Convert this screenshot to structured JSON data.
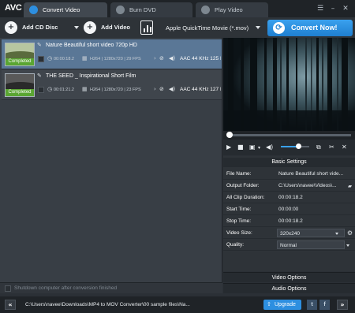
{
  "app": {
    "logo": "AVC"
  },
  "tabs": [
    {
      "label": "Convert Video",
      "icon": "refresh-icon",
      "active": true
    },
    {
      "label": "Burn DVD",
      "icon": "disc-icon",
      "active": false
    },
    {
      "label": "Play Video",
      "icon": "play-icon",
      "active": false
    }
  ],
  "window_controls": {
    "menu": "☰",
    "minimize": "–",
    "close": "✕"
  },
  "toolbar": {
    "add_cd_label": "Add CD Disc",
    "add_video_label": "Add Video",
    "format_value": "Apple QuickTime Movie (*.mov)",
    "convert_label": "Convert Now!"
  },
  "files": [
    {
      "title": "Nature Beautiful short video 720p HD",
      "status": "Completed",
      "duration": "00:00:18.2",
      "video_info": "H264 | 1280x720 | 29 FPS",
      "audio_info": "AAC 44 KHz 125 K",
      "selected": true
    },
    {
      "title": "THE SEED _ Inspirational Short Film",
      "status": "Completed",
      "duration": "00:01:21.2",
      "video_info": "H264 | 1280x720 | 23 FPS",
      "audio_info": "AAC 44 KHz 127 K",
      "selected": false
    }
  ],
  "shutdown_label": "Shutdown computer after conversion finished",
  "player": {
    "seek_fraction": 0.02,
    "volume_fraction": 0.62
  },
  "settings": {
    "header": "Basic Settings",
    "rows": [
      {
        "key": "File Name:",
        "value": "Nature Beautiful short vide..."
      },
      {
        "key": "Output Folder:",
        "value": "C:\\Users\\navee\\Videos\\..."
      },
      {
        "key": "All Clip Duration:",
        "value": "00:00:18.2"
      },
      {
        "key": "Start Time:",
        "value": "00:00:00"
      },
      {
        "key": "Stop Time:",
        "value": "00:00:18.2"
      },
      {
        "key": "Video Size:",
        "value": "320x240"
      },
      {
        "key": "Quality:",
        "value": "Normal"
      }
    ],
    "video_options": "Video Options",
    "audio_options": "Audio Options"
  },
  "statusbar": {
    "back": "«",
    "forward": "»",
    "output_path": "C:\\Users\\navee\\Downloads\\MP4 to MOV Converter\\00 sample files\\Na...",
    "upgrade_label": "Upgrade",
    "twitter": "t",
    "facebook": "f"
  },
  "colors": {
    "accent": "#2d8fe0",
    "completed_badge": "#5aa532",
    "selected_row": "#5a7796"
  }
}
